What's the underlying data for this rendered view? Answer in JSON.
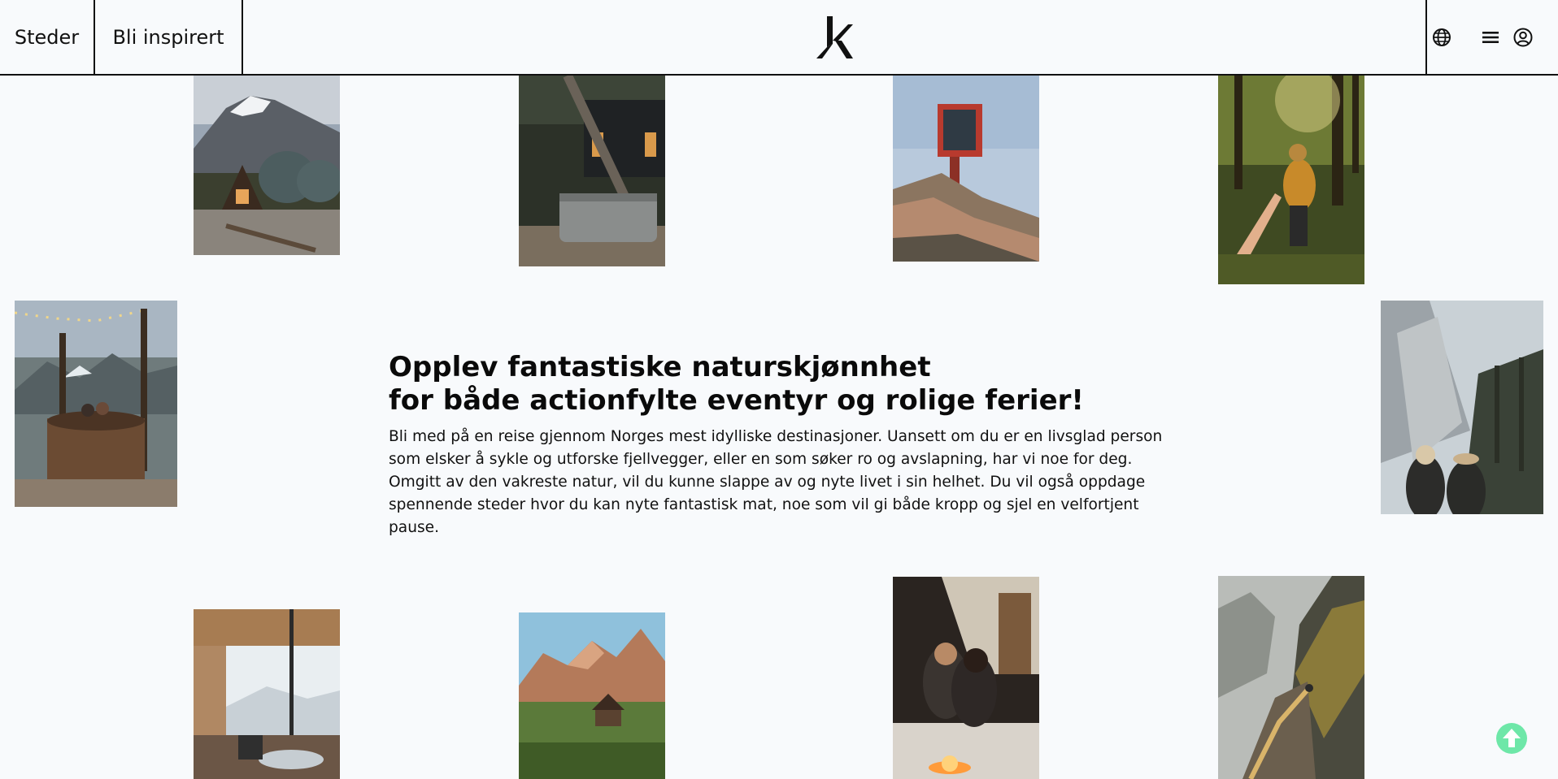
{
  "header": {
    "nav": [
      {
        "label": "Steder"
      },
      {
        "label": "Bli inspirert"
      }
    ],
    "logo_letter": "k",
    "icons": [
      "globe-icon",
      "menu-icon",
      "user-circle-icon"
    ]
  },
  "hero": {
    "headline_line1": "Opplev fantastiske naturskjønnhet",
    "headline_line2": "for både actionfylte eventyr og rolige ferier!",
    "body": "Bli med på en reise gjennom Norges mest idylliske destinasjoner. Uansett om du er en livsglad person som elsker å sykle og utforske fjellvegger, eller en som søker ro og avslapning, har vi noe for deg. Omgitt av den vakreste natur, vil du kunne slappe av og nyte livet i sin helhet. Du vil også oppdage spennende steder hvor du kan nyte fantastisk mat, noe som vil gi både kropp og sjel en velfortjent pause."
  },
  "photos": [
    {
      "name": "photo-mountain-domes"
    },
    {
      "name": "photo-cabin-bathtub"
    },
    {
      "name": "photo-red-glass-cabin"
    },
    {
      "name": "photo-forest-hand"
    },
    {
      "name": "photo-hot-tub-lights"
    },
    {
      "name": "photo-hikers-valley"
    },
    {
      "name": "photo-cabin-interior"
    },
    {
      "name": "photo-mountain-hut"
    },
    {
      "name": "photo-couple-campfire"
    },
    {
      "name": "photo-cliff-path"
    }
  ],
  "colors": {
    "background": "#f8fafc",
    "text": "#0b0b0b",
    "scroll_button": "#6ee7a8"
  }
}
